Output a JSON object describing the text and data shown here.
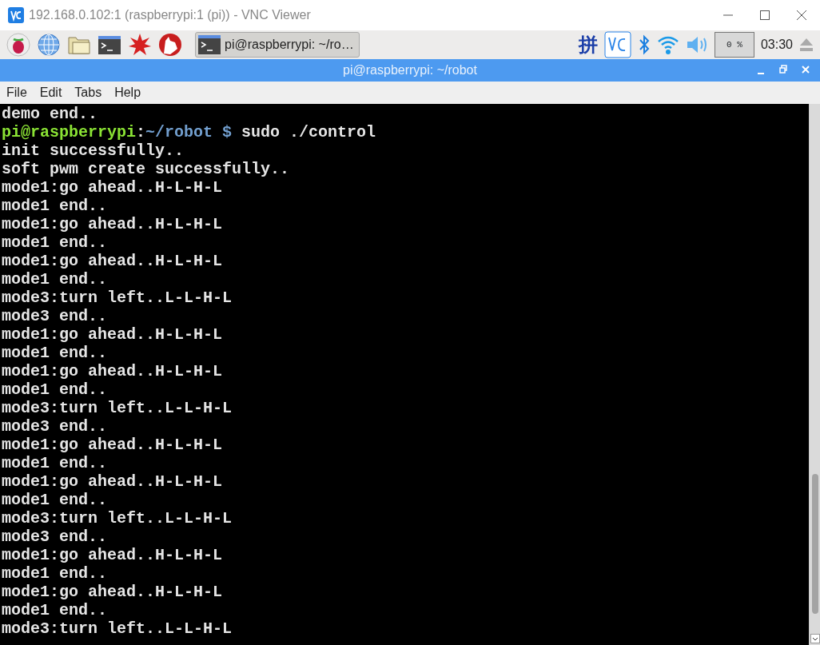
{
  "window": {
    "title": "192.168.0.102:1 (raspberrypi:1 (pi)) - VNC Viewer"
  },
  "taskbar": {
    "task": {
      "label": "pi@raspberrypi: ~/ro…",
      "selected": true
    },
    "input_method": "拼",
    "cpu": "0 %",
    "clock": "03:30"
  },
  "terminal": {
    "title": "pi@raspberrypi: ~/robot",
    "menu": [
      "File",
      "Edit",
      "Tabs",
      "Help"
    ],
    "lines": [
      {
        "kind": "output",
        "text": "demo end.."
      },
      {
        "kind": "prompt",
        "segments": [
          {
            "text": "pi@raspberrypi",
            "color": "#8ae234"
          },
          {
            "text": ":",
            "color": "#e5e5e5"
          },
          {
            "text": "~/robot $",
            "color": "#729fcf"
          },
          {
            "text": "sudo ./control",
            "color": "#e5e5e5"
          }
        ]
      },
      {
        "kind": "output",
        "text": "init successfully.."
      },
      {
        "kind": "output",
        "text": "soft pwm create successfully.."
      },
      {
        "kind": "output",
        "text": "mode1:go ahead..H-L-H-L"
      },
      {
        "kind": "output",
        "text": "mode1 end.."
      },
      {
        "kind": "output",
        "text": "mode1:go ahead..H-L-H-L"
      },
      {
        "kind": "output",
        "text": "mode1 end.."
      },
      {
        "kind": "output",
        "text": "mode1:go ahead..H-L-H-L"
      },
      {
        "kind": "output",
        "text": "mode1 end.."
      },
      {
        "kind": "output",
        "text": "mode3:turn left..L-L-H-L"
      },
      {
        "kind": "output",
        "text": "mode3 end.."
      },
      {
        "kind": "output",
        "text": "mode1:go ahead..H-L-H-L"
      },
      {
        "kind": "output",
        "text": "mode1 end.."
      },
      {
        "kind": "output",
        "text": "mode1:go ahead..H-L-H-L"
      },
      {
        "kind": "output",
        "text": "mode1 end.."
      },
      {
        "kind": "output",
        "text": "mode3:turn left..L-L-H-L"
      },
      {
        "kind": "output",
        "text": "mode3 end.."
      },
      {
        "kind": "output",
        "text": "mode1:go ahead..H-L-H-L"
      },
      {
        "kind": "output",
        "text": "mode1 end.."
      },
      {
        "kind": "output",
        "text": "mode1:go ahead..H-L-H-L"
      },
      {
        "kind": "output",
        "text": "mode1 end.."
      },
      {
        "kind": "output",
        "text": "mode3:turn left..L-L-H-L"
      },
      {
        "kind": "output",
        "text": "mode3 end.."
      },
      {
        "kind": "output",
        "text": "mode1:go ahead..H-L-H-L"
      },
      {
        "kind": "output",
        "text": "mode1 end.."
      },
      {
        "kind": "output",
        "text": "mode1:go ahead..H-L-H-L"
      },
      {
        "kind": "output",
        "text": "mode1 end.."
      },
      {
        "kind": "output",
        "text": "mode3:turn left..L-L-H-L"
      }
    ]
  }
}
